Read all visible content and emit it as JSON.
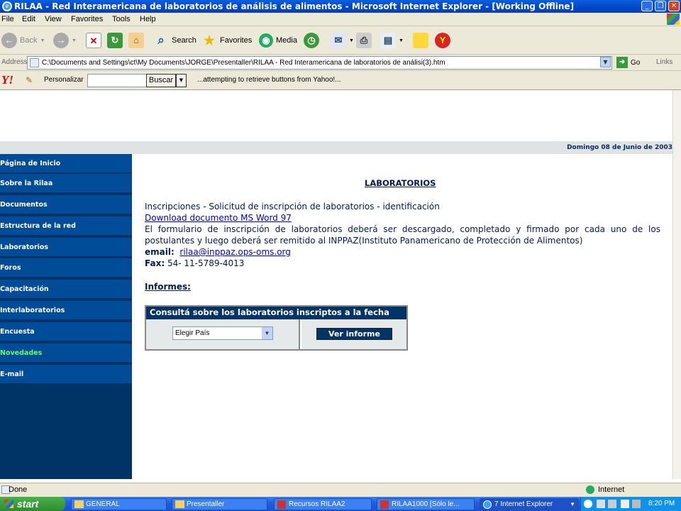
{
  "window": {
    "title": "RILAA - Red Interamericana de laboratorios de análisis de alimentos - Microsoft Internet Explorer - [Working Offline]"
  },
  "menu": [
    "File",
    "Edit",
    "View",
    "Favorites",
    "Tools",
    "Help"
  ],
  "toolbar": {
    "back": "Back",
    "search": "Search",
    "favorites": "Favorites",
    "media": "Media"
  },
  "address": {
    "label": "Address",
    "url": "C:\\Documents and Settings\\ct\\My Documents\\JORGE\\Presentaller\\RILAA - Red Interamericana de laboratorios de análisi(3).htm",
    "go": "Go",
    "links": "Links"
  },
  "yahoo": {
    "personalize": "Personalizar",
    "buscar": "Buscar",
    "status": "...attempting to retrieve buttons from Yahoo!..."
  },
  "page": {
    "date": "Domingo 08 de Junio de 2003",
    "nav": [
      "Página de Inicio",
      "Sobre la Rilaa",
      "Documentos",
      "Estructura de la red",
      "Laboratorios",
      "Foros",
      "Capacitación",
      "Interlaboratorios",
      "Encuesta",
      "Novedades",
      "E-mail"
    ],
    "nav_highlight_color": "#66ff66",
    "title": "LABORATORIOS",
    "line1": "Inscripciones - Solicitud de inscripción de laboratorios - identificación",
    "download": "Download documento MS Word 97",
    "para": "El formulario de inscripción de laboratorios deberá ser descargado, completado y firmado por cada uno de los postulantes y luego deberá ser remitido al INPPAZ(Instituto Panamericano de Protección de Alimentos)",
    "email_label": "email:",
    "email": "rilaa@inppaz.ops-oms.org",
    "fax_label": "Fax:",
    "fax": "54- 11-5789-4013",
    "informes": "Informes:",
    "consulta_title": "Consultá sobre los laboratorios inscriptos a la fecha",
    "select_value": "Elegir País",
    "ver_informe": "Ver informe"
  },
  "status": {
    "left": "Done",
    "zone": "Internet"
  },
  "taskbar": {
    "start": "start",
    "tasks": [
      "GENERAL",
      "Presentaller",
      "Recursos RILAA2",
      "RILAA1000 [Sólo le...",
      "7 Internet Explorer"
    ],
    "time": "8:20 PM"
  }
}
